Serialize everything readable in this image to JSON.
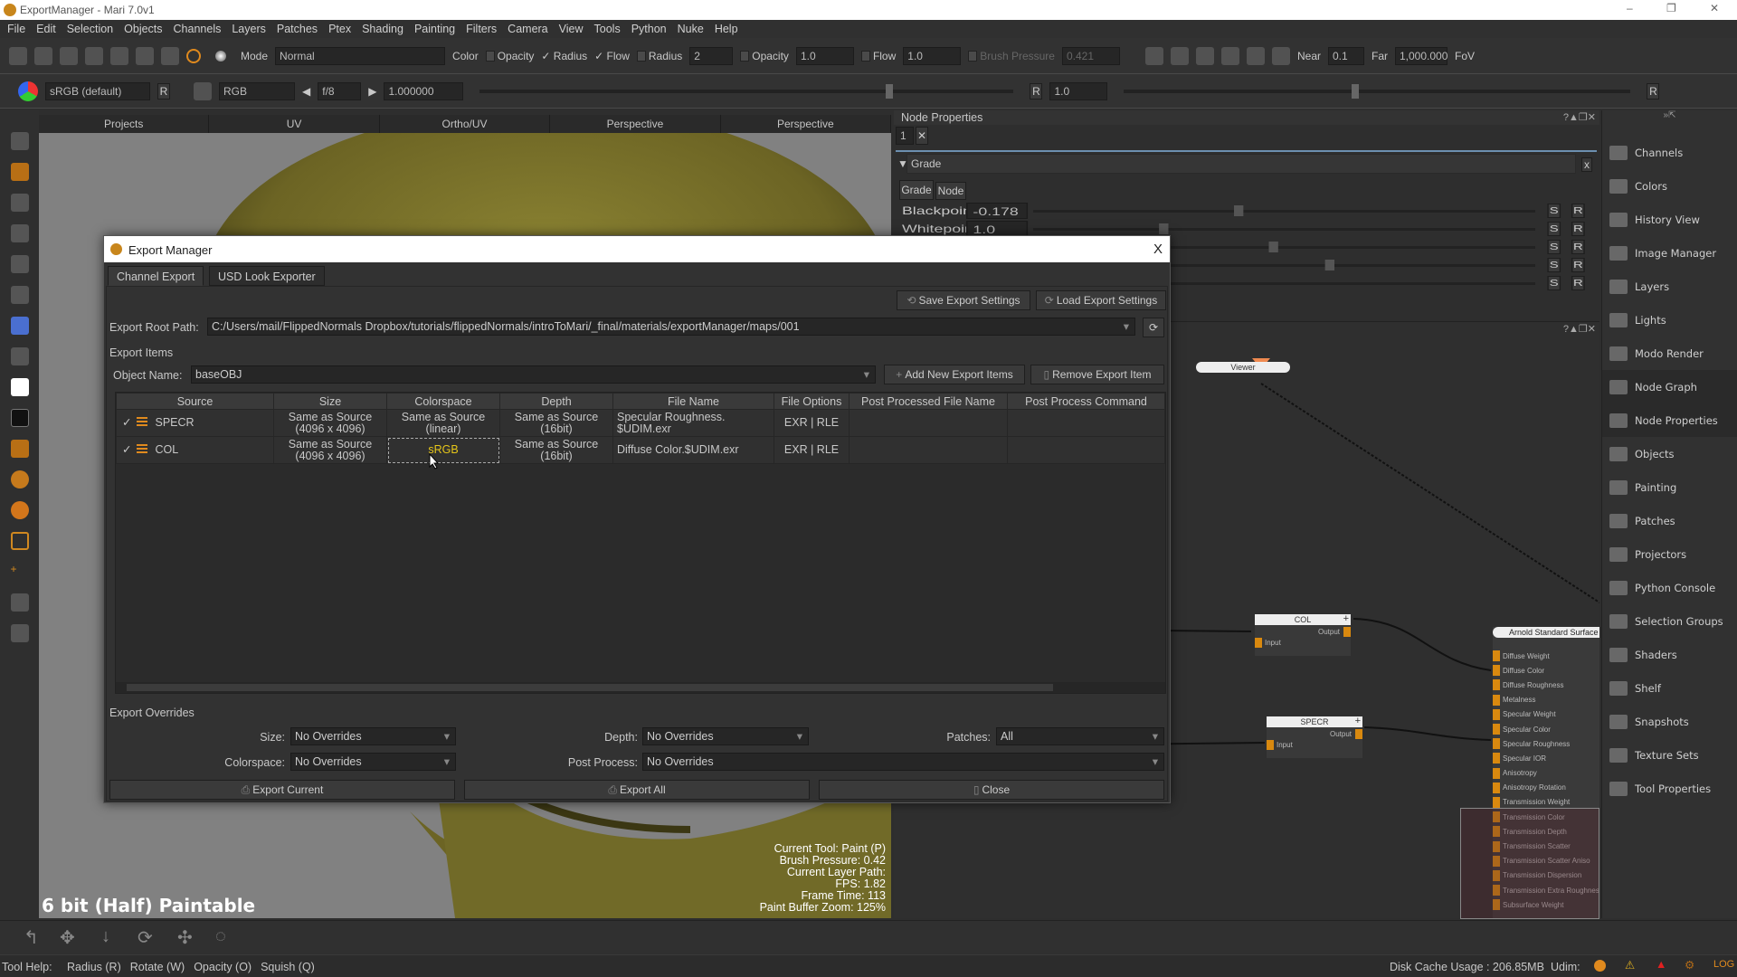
{
  "window": {
    "title": "ExportManager - Mari 7.0v1",
    "controls": [
      "–",
      "❐",
      "✕"
    ]
  },
  "menu": [
    "File",
    "Edit",
    "Selection",
    "Objects",
    "Channels",
    "Layers",
    "Patches",
    "Ptex",
    "Shading",
    "Painting",
    "Filters",
    "Camera",
    "View",
    "Tools",
    "Python",
    "Nuke",
    "Help"
  ],
  "toolbar1": {
    "mode_label": "Mode",
    "mode_value": "Normal",
    "color_label": "Color",
    "opacity_label": "Opacity",
    "radius_chk_label": "Radius",
    "flow_chk_label": "Flow",
    "radius_label": "Radius",
    "radius_value": "2",
    "opacity2_label": "Opacity",
    "opacity_value": "1.0",
    "flow_label": "Flow",
    "flow_value": "1.0",
    "brush_pressure_label": "Brush Pressure",
    "brush_pressure_value": "0.421",
    "near_label": "Near",
    "near_value": "0.1",
    "far_label": "Far",
    "far_value": "1,000.000",
    "fov_label": "FoV"
  },
  "toolbar2": {
    "colorspace": "sRGB (default)",
    "r_label": "R",
    "channel": "RGB",
    "fstop": "f/8",
    "exposure": "1.000000",
    "gain_r": "R",
    "gain_value": "1.0",
    "r_end": "R",
    "exposure_slider": 0.76,
    "gain_slider": 0.45
  },
  "viewport": {
    "tabs": [
      "Projects",
      "UV",
      "Ortho/UV",
      "Perspective",
      "Perspective"
    ],
    "depth_label": "6 bit (Half) Paintable",
    "info": [
      "Current Tool: Paint (P)",
      "Brush Pressure: 0.42",
      "Current Layer Path:",
      "FPS: 1.82",
      "Frame Time: 113",
      "Paint Buffer Zoom: 125%"
    ]
  },
  "node_properties": {
    "title": "Node Properties",
    "field_value": "1",
    "section": "Grade",
    "close": "x",
    "tabs": [
      "Grade",
      "Node"
    ],
    "rows": [
      {
        "label": "Blackpoint",
        "value": "-0.178",
        "slider": 0.4
      },
      {
        "label": "Whitepoint",
        "value": "1.0",
        "slider": 0.25
      }
    ],
    "s_label": "S",
    "r_label": "R"
  },
  "node_graph": {
    "viewer": "Viewer",
    "nodes": [
      {
        "name": "COL",
        "input": "Input",
        "output": "Output"
      },
      {
        "name": "SPECR",
        "input": "Input",
        "output": "Output"
      }
    ],
    "shader": {
      "name": "Arnold Standard Surface",
      "ports": [
        "Diffuse Weight",
        "Diffuse Color",
        "Diffuse Roughness",
        "Metalness",
        "Specular Weight",
        "Specular Color",
        "Specular Roughness",
        "Specular IOR",
        "Anisotropy",
        "Anisotropy Rotation",
        "Transmission Weight",
        "Transmission Color",
        "Transmission Depth",
        "Transmission Scatter",
        "Transmission Scatter Aniso",
        "Transmission Dispersion",
        "Transmission Extra Roughness",
        "Subsurface Weight"
      ]
    },
    "plus": "+"
  },
  "sidebar": [
    {
      "label": "Channels"
    },
    {
      "label": "Colors"
    },
    {
      "label": "History View"
    },
    {
      "label": "Image Manager"
    },
    {
      "label": "Layers"
    },
    {
      "label": "Lights"
    },
    {
      "label": "Modo Render"
    },
    {
      "label": "Node Graph",
      "active": true
    },
    {
      "label": "Node Properties",
      "active": true
    },
    {
      "label": "Objects"
    },
    {
      "label": "Painting"
    },
    {
      "label": "Patches"
    },
    {
      "label": "Projectors"
    },
    {
      "label": "Python Console"
    },
    {
      "label": "Selection Groups"
    },
    {
      "label": "Shaders"
    },
    {
      "label": "Shelf"
    },
    {
      "label": "Snapshots"
    },
    {
      "label": "Texture Sets"
    },
    {
      "label": "Tool Properties"
    }
  ],
  "dialog": {
    "title": "Export Manager",
    "close": "X",
    "tabs": [
      "Channel Export",
      "USD Look Exporter"
    ],
    "save_settings": "Save Export Settings",
    "load_settings": "Load Export Settings",
    "root_path_label": "Export Root Path:",
    "root_path": "C:/Users/mail/FlippedNormals Dropbox/tutorials/flippedNormals/introToMari/_final/materials/exportManager/maps/001",
    "export_items_label": "Export Items",
    "object_name_label": "Object Name:",
    "object_name": "baseOBJ",
    "add_items": "Add New Export Items",
    "remove_item": "Remove Export Item",
    "columns": [
      "Source",
      "Size",
      "Colorspace",
      "Depth",
      "File Name",
      "File Options",
      "Post Processed File Name",
      "Post Process Command"
    ],
    "rows": [
      {
        "checked": "✓",
        "source": "SPECR",
        "size": [
          "Same as Source",
          "(4096 x 4096)"
        ],
        "colorspace": [
          "Same as Source",
          "(linear)"
        ],
        "depth": [
          "Same as Source",
          "(16bit)"
        ],
        "file_name": [
          "Specular Roughness.",
          "$UDIM.exr"
        ],
        "file_options": "EXR | RLE",
        "post_name": "",
        "post_cmd": ""
      },
      {
        "checked": "✓",
        "source": "COL",
        "size": [
          "Same as Source",
          "(4096 x 4096)"
        ],
        "colorspace": [
          "sRGB",
          ""
        ],
        "depth": [
          "Same as Source",
          "(16bit)"
        ],
        "file_name": [
          "Diffuse Color.$UDIM.exr",
          ""
        ],
        "file_options": "EXR | RLE",
        "post_name": "",
        "post_cmd": ""
      }
    ],
    "overrides_label": "Export Overrides",
    "size_label": "Size:",
    "size_value": "No Overrides",
    "depth_label": "Depth:",
    "depth_value": "No Overrides",
    "patches_label": "Patches:",
    "patches_value": "All",
    "colorspace_label": "Colorspace:",
    "colorspace_value": "No Overrides",
    "post_process_label": "Post Process:",
    "post_process_value": "No Overrides",
    "export_current": "Export Current",
    "export_all": "Export All",
    "close_button": "Close"
  },
  "status": {
    "tool_help": "Tool Help:",
    "hints": [
      "Radius (R)",
      "Rotate (W)",
      "Opacity (O)",
      "Squish (Q)"
    ],
    "disk_cache": "Disk Cache Usage : 206.85MB",
    "udim": "Udim:"
  },
  "colors": {
    "accent": "#e08a1e",
    "selected_text": "#e6c619",
    "port": "#d9890f"
  }
}
